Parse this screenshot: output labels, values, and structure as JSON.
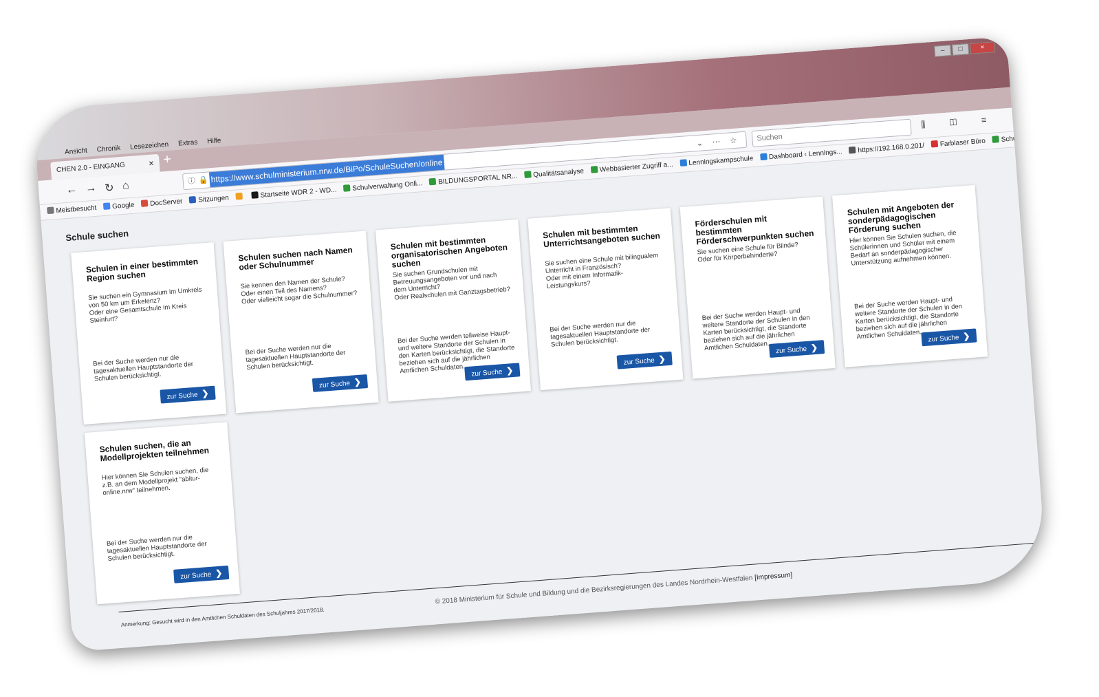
{
  "browser": {
    "menu": [
      "Ansicht",
      "Chronik",
      "Lesezeichen",
      "Extras",
      "Hilfe"
    ],
    "tab_title": "CHEN 2.0 - EINGANG",
    "url": "https://www.schulministerium.nrw.de/BiPo/SchuleSuchen/online",
    "search_placeholder": "Suchen",
    "bookmarks": [
      {
        "label": "Meistbesucht",
        "color": "#777777"
      },
      {
        "label": "Google",
        "color": "#4285f4"
      },
      {
        "label": "DocServer",
        "color": "#d94a3a"
      },
      {
        "label": "Sitzungen",
        "color": "#2b5fbf"
      },
      {
        "label": "",
        "color": "#f0a020"
      },
      {
        "label": "Startseite WDR 2 - WD...",
        "color": "#1a1a1a"
      },
      {
        "label": "Schulverwaltung Onli...",
        "color": "#2f9a3a"
      },
      {
        "label": "BILDUNGSPORTAL NR...",
        "color": "#2f9a3a"
      },
      {
        "label": "Qualitätsanalyse",
        "color": "#2f9a3a"
      },
      {
        "label": "Webbasierter Zugriff a...",
        "color": "#2f9a3a"
      },
      {
        "label": "Lenningskampschule",
        "color": "#2b7fd8"
      },
      {
        "label": "Dashboard ‹ Lennings...",
        "color": "#2b7fd8"
      },
      {
        "label": "https://192.168.0.201/",
        "color": "#555555"
      },
      {
        "label": "Farblaser Büro",
        "color": "#d93030"
      },
      {
        "label": "Schulmail Webmail :: ...",
        "color": "#2f9a3a"
      }
    ]
  },
  "page": {
    "title": "Schule suchen",
    "button_label": "zur Suche",
    "cards": [
      {
        "title": "Schulen in einer bestimmten Region suchen",
        "desc": "Sie suchen ein Gymnasium im Umkreis von 50 km um Erkelenz?\nOder eine Gesamtschule im Kreis Steinfurt?",
        "note": "Bei der Suche werden nur die tagesaktuellen Hauptstandorte der Schulen berücksichtigt."
      },
      {
        "title": "Schulen suchen nach Namen oder Schulnummer",
        "desc": "Sie kennen den Namen der Schule?\nOder einen Teil des Namens?\nOder vielleicht sogar die Schulnummer?",
        "note": "Bei der Suche werden nur die tagesaktuellen Hauptstandorte der Schulen berücksichtigt."
      },
      {
        "title": "Schulen mit bestimmten organisatorischen Angeboten suchen",
        "desc": "Sie suchen Grundschulen mit Betreuungsangeboten vor und nach dem Unterricht?\nOder Realschulen mit Ganztagsbetrieb?",
        "note": "Bei der Suche werden teilweise Haupt- und weitere Standorte der Schulen in den Karten berücksichtigt, die Standorte beziehen sich auf die jährlichen Amtlichen Schuldaten."
      },
      {
        "title": "Schulen mit bestimmten Unterrichtsangeboten suchen",
        "desc": "Sie suchen eine Schule mit bilingualem Unterricht in Französisch?\nOder mit einem Informatik-Leistungskurs?",
        "note": "Bei der Suche werden nur die tagesaktuellen Hauptstandorte der Schulen berücksichtigt."
      },
      {
        "title": "Förderschulen mit bestimmten Förderschwerpunkten suchen",
        "desc": "Sie suchen eine Schule für Blinde?\nOder für Körperbehinderte?",
        "note": "Bei der Suche werden Haupt- und weitere Standorte der Schulen in den Karten berücksichtigt, die Standorte beziehen sich auf die jährlichen Amtlichen Schuldaten."
      },
      {
        "title": "Schulen mit Angeboten der sonderpädagogischen Förderung suchen",
        "desc": "Hier können Sie Schulen suchen, die Schülerinnen und Schüler mit einem Bedarf an sonderpädagogischer Unterstützung aufnehmen können.",
        "note": "Bei der Suche werden Haupt- und weitere Standorte der Schulen in den Karten berücksichtigt, die Standorte beziehen sich auf die jährlichen Amtlichen Schuldaten."
      },
      {
        "title": "Schulen suchen, die an Modellprojekten teilnehmen",
        "desc": "Hier können Sie Schulen suchen, die z.B. an dem Modellprojekt \"abitur-online.nrw\" teilnehmen.",
        "note": "Bei der Suche werden nur die tagesaktuellen Hauptstandorte der Schulen berücksichtigt."
      }
    ],
    "anmerkung": "Anmerkung: Gesucht wird in den Amtlichen Schuldaten des Schuljahres 2017/2018.",
    "copyright": "© 2018 Ministerium für Schule und Bildung und die Bezirksregierungen des Landes Nordrhein-Westfalen",
    "impressum": "[Impressum]"
  }
}
